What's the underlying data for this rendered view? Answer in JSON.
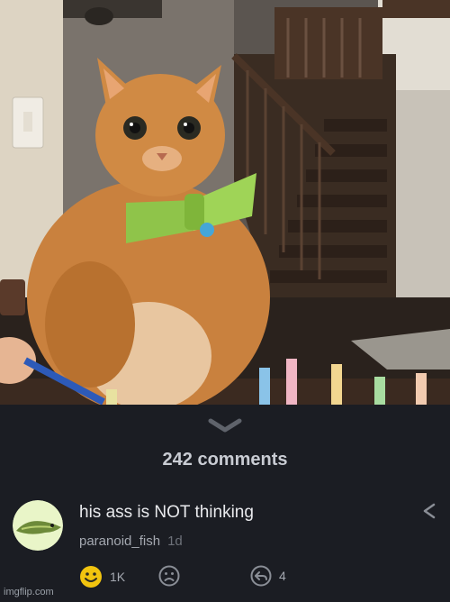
{
  "post": {
    "photo_alt": "orange cat wearing green bow tie with birthday candles"
  },
  "comments_header": {
    "count_label": "242 comments"
  },
  "comment": {
    "text": "his ass is NOT thinking",
    "author": "paranoid_fish",
    "time": "1d",
    "likes": "1K",
    "replies": "4"
  },
  "watermark": {
    "text": "imgflip.com"
  },
  "colors": {
    "panel_bg": "#1b1d23",
    "like_yellow": "#f1c40f",
    "muted_text": "#a4a8b0"
  },
  "icons": {
    "collapse": "chevron-down-icon",
    "reply": "reply-arrow-icon",
    "like": "smile-icon",
    "dislike": "frown-icon",
    "replies": "replies-icon"
  }
}
